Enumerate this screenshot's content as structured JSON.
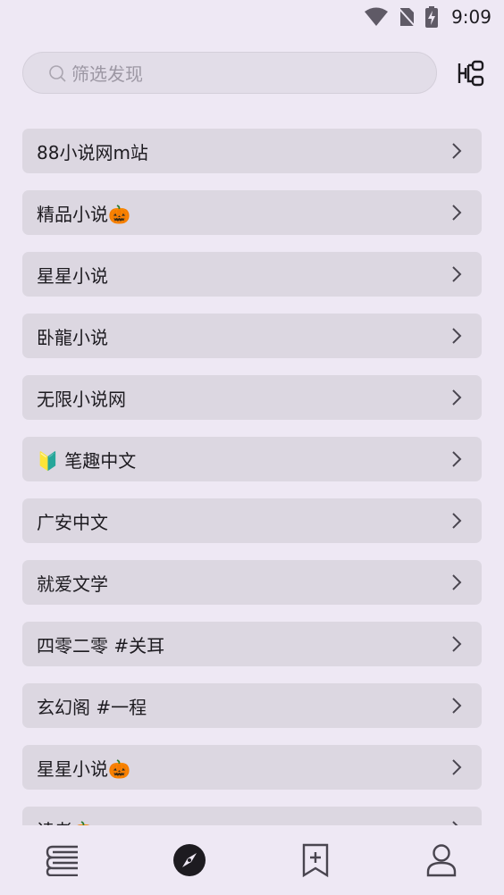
{
  "status": {
    "time": "9:09"
  },
  "search": {
    "placeholder": "筛选发现"
  },
  "sources": [
    "88小说网m站",
    "精品小说🎃",
    "星星小说",
    "卧龍小说",
    "无限小说网",
    "🔰 笔趣中文",
    "广安中文",
    "就爱文学",
    "四零二零 #关耳",
    "玄幻阁 #一程",
    "星星小说🎃",
    "读者🎃"
  ],
  "nav": {
    "items": [
      "bookshelf-icon",
      "explore-icon",
      "rss-bookmark-icon",
      "profile-icon"
    ],
    "active": "explore-icon"
  },
  "colors": {
    "background": "#eee8f4",
    "item": "#dcd7e1",
    "text": "#1d1b20"
  }
}
